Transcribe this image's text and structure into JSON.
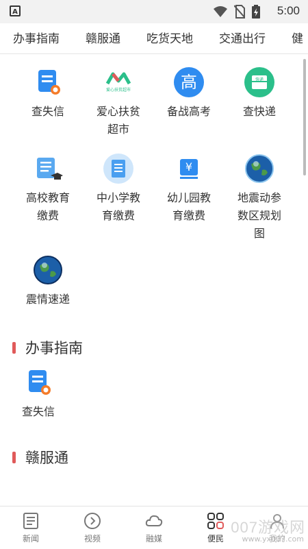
{
  "status": {
    "time": "5:00",
    "app_badge": "A"
  },
  "top_tabs": [
    "办事指南",
    "赣服通",
    "吃货天地",
    "交通出行",
    "健"
  ],
  "services": [
    {
      "label": "查失信",
      "icon": "credit-check-icon"
    },
    {
      "label": "爱心扶贫超市",
      "icon": "poverty-aid-market-icon",
      "logo_text": "爱心扶贫超市"
    },
    {
      "label": "备战高考",
      "icon": "gaokao-icon",
      "glyph": "高"
    },
    {
      "label": "查快递",
      "icon": "express-box-icon",
      "glyph": "快递"
    },
    {
      "label": "高校教育缴费",
      "icon": "university-fee-icon"
    },
    {
      "label": "中小学教育缴费",
      "icon": "school-fee-icon"
    },
    {
      "label": "幼儿园教育缴费",
      "icon": "kindergarten-fee-icon",
      "glyph": "¥"
    },
    {
      "label": "地震动参数区规划图",
      "icon": "earth-globe-icon"
    },
    {
      "label": "震情速递",
      "icon": "earth-globe-icon"
    }
  ],
  "sections": [
    {
      "title": "办事指南",
      "items": [
        {
          "label": "查失信",
          "icon": "credit-check-icon"
        }
      ]
    },
    {
      "title": "赣服通"
    }
  ],
  "bottom_nav": [
    {
      "label": "新闻",
      "icon": "news-icon"
    },
    {
      "label": "视频",
      "icon": "video-play-icon"
    },
    {
      "label": "融媒",
      "icon": "cloud-icon"
    },
    {
      "label": "便民",
      "icon": "apps-grid-icon",
      "active": true
    },
    {
      "label": "我的",
      "icon": "user-icon"
    }
  ],
  "watermark": {
    "text": "007游戏网",
    "url": "www.yx007.com"
  },
  "colors": {
    "accent_red": "#e05a5a",
    "blue": "#2f8cf0",
    "green": "#2bbf8a"
  }
}
